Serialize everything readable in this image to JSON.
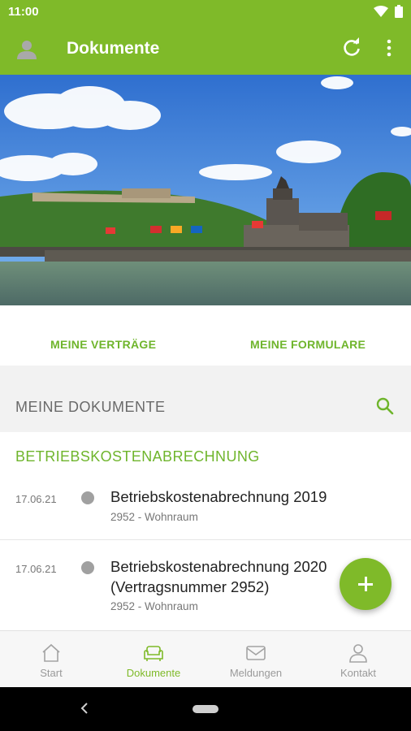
{
  "status": {
    "time": "11:00"
  },
  "appbar": {
    "title": "Dokumente"
  },
  "links": {
    "contracts": "MEINE VERTRÄGE",
    "forms": "MEINE FORMULARE"
  },
  "section": {
    "title": "MEINE DOKUMENTE"
  },
  "category": "BETRIEBSKOSTENABRECHNUNG",
  "documents": [
    {
      "date": "17.06.21",
      "title": "Betriebskostenabrechnung 2019",
      "subtitle": "2952 - Wohnraum"
    },
    {
      "date": "17.06.21",
      "title_line1": "Betriebskostenabrechnung 2020",
      "title_line2": "(Vertragsnummer 2952)",
      "subtitle": "2952 - Wohnraum"
    }
  ],
  "bottomnav": [
    {
      "label": "Start",
      "icon": "home-icon",
      "active": false
    },
    {
      "label": "Dokumente",
      "icon": "couch-icon",
      "active": true
    },
    {
      "label": "Meldungen",
      "icon": "mail-icon",
      "active": false
    },
    {
      "label": "Kontakt",
      "icon": "person-icon",
      "active": false
    }
  ],
  "colors": {
    "accent": "#7fba29",
    "accent_text": "#6fb52c",
    "section_bg": "#f2f2f2",
    "dot": "#a0a0a0"
  }
}
